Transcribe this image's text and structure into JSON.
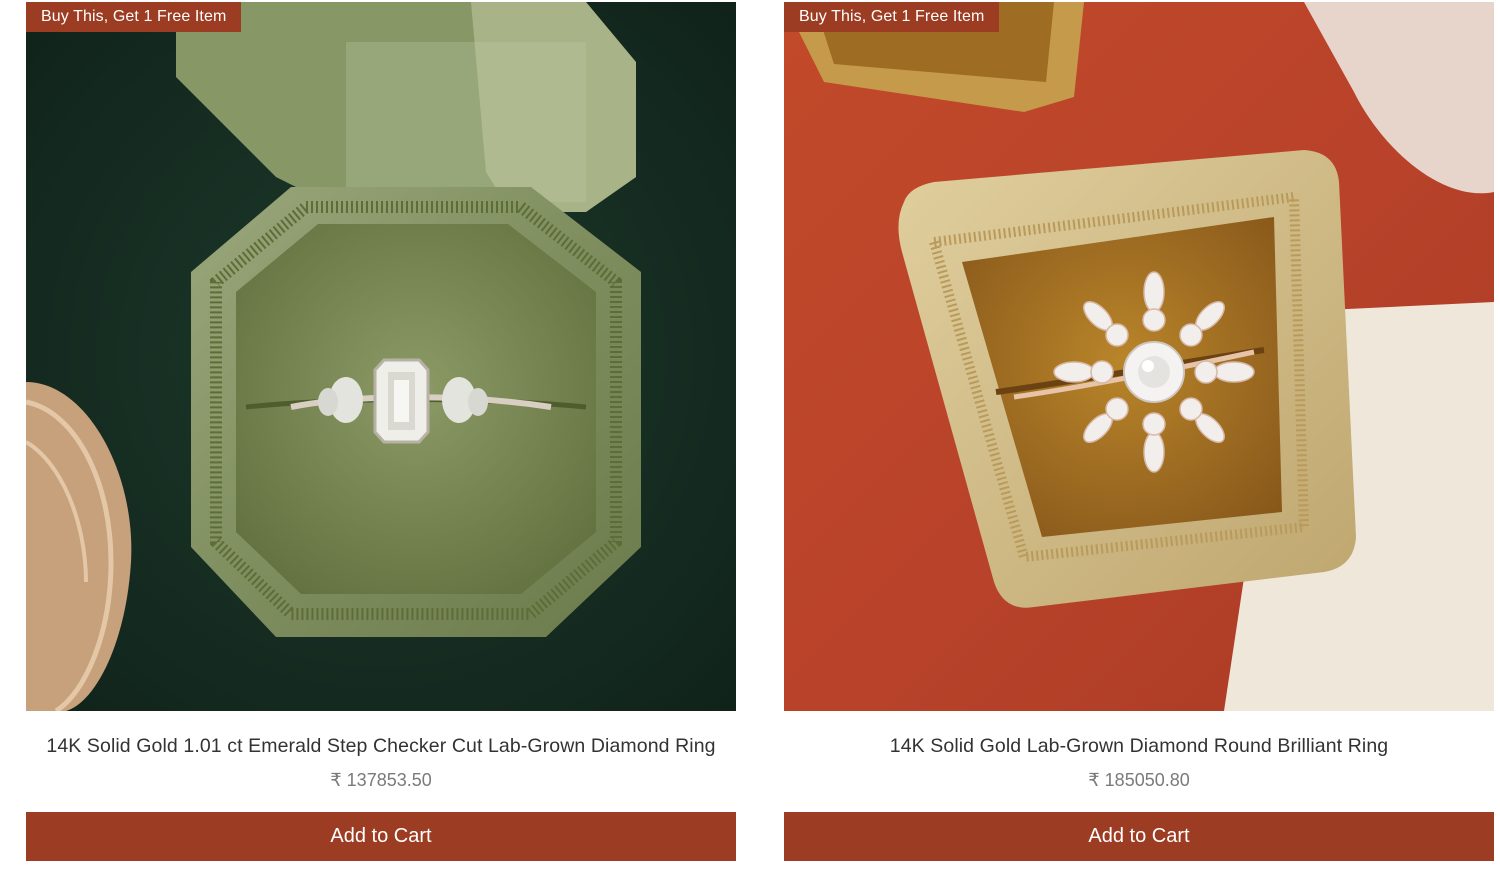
{
  "products": [
    {
      "badge": "Buy This, Get 1 Free Item",
      "title": "14K Solid Gold 1.01 ct Emerald Step Checker Cut Lab-Grown Diamond Ring",
      "price": "₹ 137853.50",
      "cta": "Add to Cart"
    },
    {
      "badge": "Buy This, Get 1 Free Item",
      "title": "14K Solid Gold Lab-Grown Diamond Round Brilliant Ring",
      "price": "₹ 185050.80",
      "cta": "Add to Cart"
    }
  ],
  "colors": {
    "accent": "#9c3c22",
    "badge_text": "#ffffff",
    "title_text": "#333333",
    "price_text": "#7a7a7a"
  }
}
